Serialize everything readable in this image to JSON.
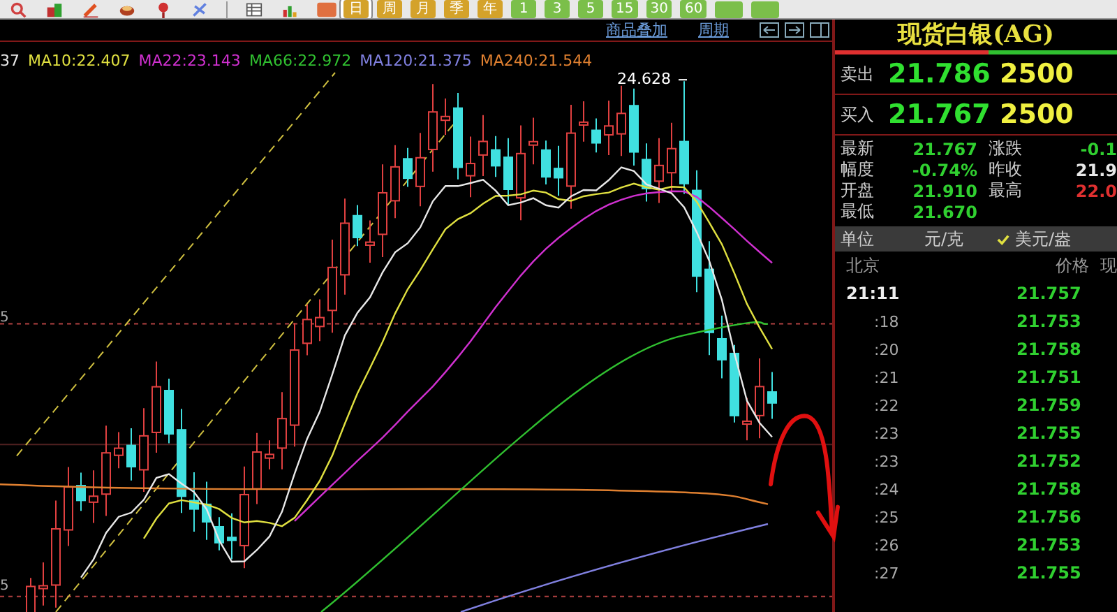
{
  "toolbar": {
    "periods": [
      {
        "label": "日",
        "selected": true
      },
      {
        "label": "周",
        "selected": false
      },
      {
        "label": "月",
        "selected": false
      },
      {
        "label": "季",
        "selected": false
      },
      {
        "label": "年",
        "selected": false
      },
      {
        "label": "1",
        "selected": false
      },
      {
        "label": "3",
        "selected": false
      },
      {
        "label": "5",
        "selected": false
      },
      {
        "label": "15",
        "selected": false
      },
      {
        "label": "30",
        "selected": false
      },
      {
        "label": "60",
        "selected": false
      }
    ]
  },
  "chart_header": {
    "links": [
      "商品叠加",
      "周期"
    ]
  },
  "legend": [
    {
      "label": "37",
      "color": "#e8e8e8"
    },
    {
      "label": "MA10:22.407",
      "color": "#e0e040"
    },
    {
      "label": "MA22:23.143",
      "color": "#d030d0"
    },
    {
      "label": "MA66:22.972",
      "color": "#30c030"
    },
    {
      "label": "MA120:21.375",
      "color": "#8080e0"
    },
    {
      "label": "MA240:21.544",
      "color": "#e08030"
    }
  ],
  "chart": {
    "peak_label": "24.628",
    "axis_labels": [
      "5",
      "5"
    ]
  },
  "quote": {
    "title": "现货白银(AG)",
    "sell": {
      "label": "卖出",
      "price": "21.786",
      "volume": "2500"
    },
    "buy": {
      "label": "买入",
      "price": "21.767",
      "volume": "2500"
    },
    "stats": [
      {
        "label": "最新",
        "value": "21.767",
        "color": "#30d030"
      },
      {
        "label": "涨跌",
        "value": "-0.1",
        "color": "#30d030"
      },
      {
        "label": "幅度",
        "value": "-0.74%",
        "color": "#30d030"
      },
      {
        "label": "昨收",
        "value": "21.9",
        "color": "#e8e8e8"
      },
      {
        "label": "开盘",
        "value": "21.910",
        "color": "#30d030"
      },
      {
        "label": "最高",
        "value": "22.0",
        "color": "#e03030"
      },
      {
        "label": "最低",
        "value": "21.670",
        "color": "#30d030"
      }
    ],
    "unit": {
      "label": "单位",
      "options": [
        {
          "label": "元/克",
          "checked": false
        },
        {
          "label": "美元/盎",
          "checked": true
        }
      ]
    },
    "ticks": {
      "columns": [
        "北京",
        "价格",
        "现"
      ],
      "rows": [
        {
          "time": "21:11",
          "price": "21.757"
        },
        {
          "time": ":18",
          "price": "21.753"
        },
        {
          "time": ":20",
          "price": "21.758"
        },
        {
          "time": ":21",
          "price": "21.751"
        },
        {
          "time": ":22",
          "price": "21.759"
        },
        {
          "time": ":23",
          "price": "21.755"
        },
        {
          "time": ":23",
          "price": "21.752"
        },
        {
          "time": ":24",
          "price": "21.758"
        },
        {
          "time": ":25",
          "price": "21.756"
        },
        {
          "time": ":26",
          "price": "21.753"
        },
        {
          "time": ":27",
          "price": "21.755"
        }
      ]
    }
  }
}
